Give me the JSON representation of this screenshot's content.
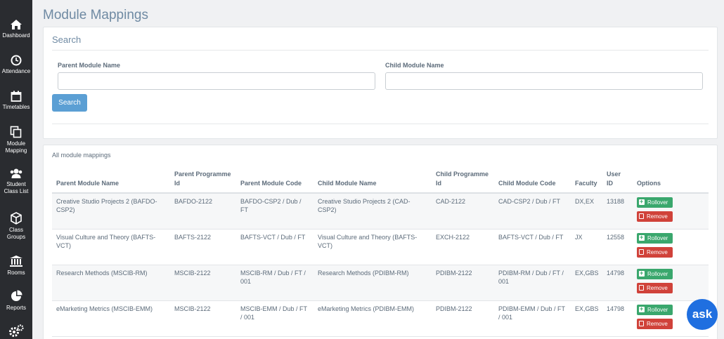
{
  "sidebar": {
    "items": [
      {
        "label": "Dashboard",
        "icon": "home-icon"
      },
      {
        "label": "Attendance",
        "icon": "clock-icon"
      },
      {
        "label": "Timetables",
        "icon": "calendar-icon"
      },
      {
        "label": "Module\nMapping",
        "icon": "copy-icon"
      },
      {
        "label": "Student\nClass List",
        "icon": "users-icon"
      },
      {
        "label": "Class\nGroups",
        "icon": "cube-icon"
      },
      {
        "label": "Rooms",
        "icon": "institution-icon"
      },
      {
        "label": "Reports",
        "icon": "pie-chart-icon"
      },
      {
        "label": "",
        "icon": "gears-icon"
      }
    ]
  },
  "page": {
    "title": "Module Mappings"
  },
  "search": {
    "heading": "Search",
    "parent_label": "Parent Module Name",
    "child_label": "Child Module Name",
    "parent_value": "",
    "child_value": "",
    "button_label": "Search"
  },
  "table": {
    "caption": "All module mappings",
    "headers": [
      "Parent Module Name",
      "Parent Programme Id",
      "Parent Module Code",
      "Child Module Name",
      "Child Programme Id",
      "Child Module Code",
      "Faculty",
      "User ID",
      "Options"
    ],
    "rollover_label": "Rollover",
    "remove_label": "Remove",
    "rows": [
      {
        "parent_name": "Creative Studio Projects 2 (BAFDO-CSP2)",
        "parent_prog": "BAFDO-2122",
        "parent_code": "BAFDO-CSP2 / Dub / FT",
        "child_name": "Creative Studio Projects 2 (CAD-CSP2)",
        "child_prog": "CAD-2122",
        "child_code": "CAD-CSP2 / Dub / FT",
        "faculty": "DX,EX",
        "user_id": "13188"
      },
      {
        "parent_name": "Visual Culture and Theory (BAFTS-VCT)",
        "parent_prog": "BAFTS-2122",
        "parent_code": "BAFTS-VCT / Dub / FT",
        "child_name": "Visual Culture and Theory (BAFTS-VCT)",
        "child_prog": "EXCH-2122",
        "child_code": "BAFTS-VCT / Dub / FT",
        "faculty": "JX",
        "user_id": "12558"
      },
      {
        "parent_name": "Research Methods (MSCIB-RM)",
        "parent_prog": "MSCIB-2122",
        "parent_code": "MSCIB-RM / Dub / FT / 001",
        "child_name": "Research Methods (PDIBM-RM)",
        "child_prog": "PDIBM-2122",
        "child_code": "PDIBM-RM / Dub / FT / 001",
        "faculty": "EX,GBS",
        "user_id": "14798"
      },
      {
        "parent_name": "eMarketing Metrics (MSCIB-EMM)",
        "parent_prog": "MSCIB-2122",
        "parent_code": "MSCIB-EMM / Dub / FT / 001",
        "child_name": "eMarketing Metrics (PDIBM-EMM)",
        "child_prog": "PDIBM-2122",
        "child_code": "PDIBM-EMM / Dub / FT / 001",
        "faculty": "EX,GBS",
        "user_id": "14798"
      }
    ]
  },
  "ask": {
    "label": "ask"
  }
}
